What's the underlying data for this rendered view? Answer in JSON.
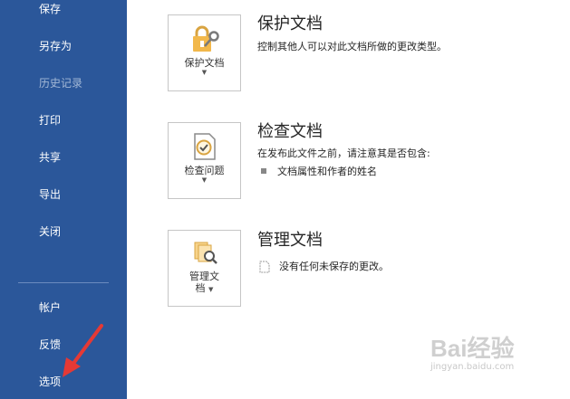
{
  "sidebar": {
    "items": [
      {
        "label": "保存",
        "state": "normal"
      },
      {
        "label": "另存为",
        "state": "normal"
      },
      {
        "label": "历史记录",
        "state": "disabled"
      },
      {
        "label": "打印",
        "state": "normal"
      },
      {
        "label": "共享",
        "state": "normal"
      },
      {
        "label": "导出",
        "state": "normal"
      },
      {
        "label": "关闭",
        "state": "normal"
      }
    ],
    "bottom_items": [
      {
        "label": "帐户"
      },
      {
        "label": "反馈"
      },
      {
        "label": "选项"
      }
    ],
    "background_color": "#2b579a"
  },
  "sections": [
    {
      "button_label": "保护文档",
      "title": "保护文档",
      "description": "控制其他人可以对此文档所做的更改类型。",
      "icon": "lock-key-icon"
    },
    {
      "button_label": "检查问题",
      "title": "检查文档",
      "description": "在发布此文件之前，请注意其是否包含:",
      "bullets": [
        "文档属性和作者的姓名"
      ],
      "icon": "checklist-icon"
    },
    {
      "button_label_line1": "管理文",
      "button_label_line2": "档",
      "title": "管理文档",
      "description": "没有任何未保存的更改。",
      "icon": "manage-document-icon"
    }
  ],
  "annotation": {
    "arrow_color": "#e53935"
  },
  "watermark": {
    "text": "Bai经验",
    "url": "jingyan.baidu.com"
  }
}
